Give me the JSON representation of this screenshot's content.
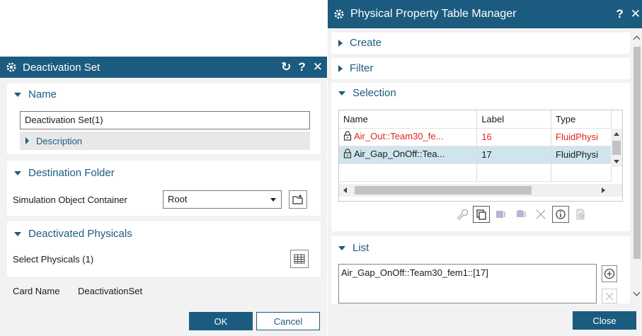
{
  "deactivation": {
    "title": "Deactivation Set",
    "reset_symbol": "↻",
    "help_symbol": "?",
    "close_symbol": "✕",
    "name_section": "Name",
    "name_value": "Deactivation Set(1)",
    "description_label": "Description",
    "destination_section": "Destination Folder",
    "container_label": "Simulation Object Container",
    "container_value": "Root",
    "physicals_section": "Deactivated Physicals",
    "select_physicals_label": "Select Physicals (1)",
    "card_name_label": "Card Name",
    "card_name_value": "DeactivationSet",
    "ok_label": "OK",
    "cancel_label": "Cancel"
  },
  "ppt": {
    "title": "Physical Property Table Manager",
    "help_symbol": "?",
    "close_symbol": "✕",
    "create_section": "Create",
    "filter_section": "Filter",
    "selection_section": "Selection",
    "columns": [
      "Name",
      "Label",
      "Type"
    ],
    "rows": [
      {
        "name": "Air_Out::Team30_fe...",
        "label": "16",
        "type": "FluidPhysi",
        "color": "#e0261c"
      },
      {
        "name": "Air_Gap_OnOff::Tea...",
        "label": "17",
        "type": "FluidPhysi",
        "color": "#1a1a1a"
      }
    ],
    "selected_row_color": "#cfe5ee",
    "list_section": "List",
    "list_value": "Air_Gap_OnOff::Team30_fem1::[17]",
    "close_label": "Close"
  },
  "colors": {
    "accent": "#1b5b80",
    "error": "#e0261c"
  }
}
